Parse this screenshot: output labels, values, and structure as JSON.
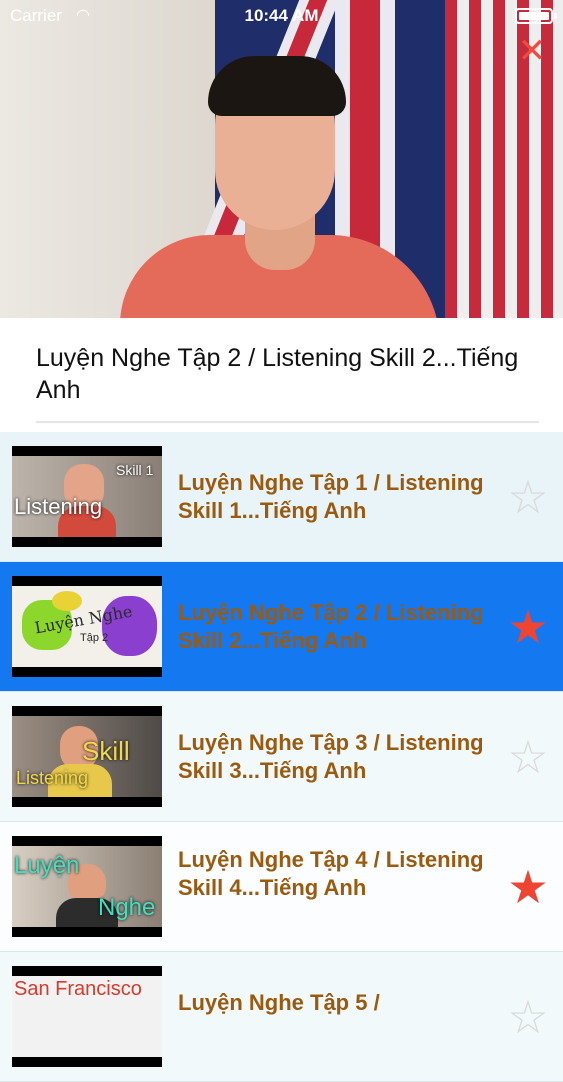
{
  "status_bar": {
    "carrier": "Carrier",
    "time": "10:44 AM"
  },
  "player": {
    "close_icon": "close-icon"
  },
  "now_playing": {
    "title": "Luyện Nghe Tập 2 / Listening Skill 2...Tiếng Anh"
  },
  "colors": {
    "accent": "#1479f0",
    "label": "#9a5a10",
    "star_on": "#f04433",
    "star_off": "#d9d9d9"
  },
  "playlist": [
    {
      "title": "Luyện Nghe Tập 1 / Listening Skill 1...Tiếng Anh",
      "thumb_text": "Listening",
      "thumb_sub": "Skill 1",
      "favorite": false,
      "selected": false
    },
    {
      "title": "Luyện Nghe Tập 2 / Listening Skill 2...Tiếng Anh",
      "thumb_text": "Luyện Nghe",
      "thumb_sub": "Tập 2",
      "favorite": true,
      "selected": true
    },
    {
      "title": "Luyện Nghe Tập 3 / Listening Skill 3...Tiếng Anh",
      "thumb_text": "Skill",
      "thumb_sub": "Listening",
      "favorite": false,
      "selected": false
    },
    {
      "title": "Luyện Nghe Tập 4 / Listening Skill 4...Tiếng Anh",
      "thumb_text": "Luyện",
      "thumb_sub": "Nghe",
      "favorite": true,
      "selected": false
    },
    {
      "title": "Luyện Nghe Tập 5 /",
      "thumb_text": "San Francisco",
      "thumb_sub": "",
      "favorite": false,
      "selected": false
    }
  ]
}
